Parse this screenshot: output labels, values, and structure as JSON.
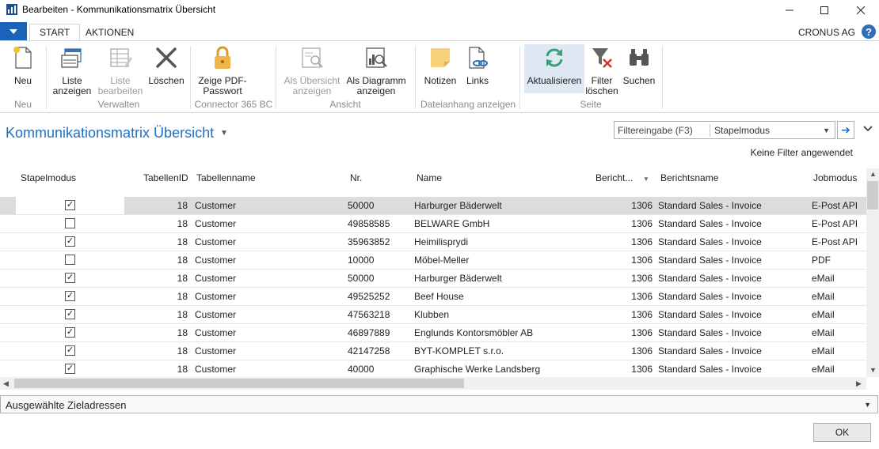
{
  "window": {
    "title": "Bearbeiten - Kommunikationsmatrix Übersicht"
  },
  "ribbon_tabs": {
    "start": "START",
    "actions": "AKTIONEN"
  },
  "company": "CRONUS AG",
  "help": "?",
  "ribbon": {
    "buttons": {
      "new": "Neu",
      "show_list": "Liste anzeigen",
      "edit_list": "Liste bearbeiten",
      "delete": "Löschen",
      "pdf_password": "Zeige PDF-Passwort",
      "show_as_overview": "Als Übersicht anzeigen",
      "show_as_chart": "Als Diagramm anzeigen",
      "notes": "Notizen",
      "links": "Links",
      "refresh": "Aktualisieren",
      "clear_filter": "Filter löschen",
      "find": "Suchen"
    },
    "groups": {
      "new": "Neu",
      "manage": "Verwalten",
      "connector": "Connector 365 BC",
      "view": "Ansicht",
      "attachments": "Dateianhang anzeigen",
      "page": "Seite"
    }
  },
  "page": {
    "title": "Kommunikationsmatrix Übersicht",
    "filter_placeholder": "Filtereingabe (F3)",
    "filter_field": "Stapelmodus",
    "no_filter": "Keine Filter angewendet"
  },
  "grid": {
    "headers": {
      "batch": "Stapelmodus",
      "table_id": "TabellenID",
      "table_name": "Tabellenname",
      "no": "Nr.",
      "name": "Name",
      "report": "Bericht...",
      "report_name": "Berichtsname",
      "job_mode": "Jobmodus"
    },
    "rows": [
      {
        "batch": true,
        "table_id": "18",
        "table_name": "Customer",
        "no": "50000",
        "name": "Harburger Bäderwelt",
        "report": "1306",
        "report_name": "Standard Sales - Invoice",
        "job_mode": "E-Post API"
      },
      {
        "batch": false,
        "table_id": "18",
        "table_name": "Customer",
        "no": "49858585",
        "name": "BELWARE GmbH",
        "report": "1306",
        "report_name": "Standard Sales - Invoice",
        "job_mode": "E-Post API"
      },
      {
        "batch": true,
        "table_id": "18",
        "table_name": "Customer",
        "no": "35963852",
        "name": "Heimilisprydi",
        "report": "1306",
        "report_name": "Standard Sales - Invoice",
        "job_mode": "E-Post API"
      },
      {
        "batch": false,
        "table_id": "18",
        "table_name": "Customer",
        "no": "10000",
        "name": "Möbel-Meller",
        "report": "1306",
        "report_name": "Standard Sales - Invoice",
        "job_mode": "PDF"
      },
      {
        "batch": true,
        "table_id": "18",
        "table_name": "Customer",
        "no": "50000",
        "name": "Harburger Bäderwelt",
        "report": "1306",
        "report_name": "Standard Sales - Invoice",
        "job_mode": "eMail"
      },
      {
        "batch": true,
        "table_id": "18",
        "table_name": "Customer",
        "no": "49525252",
        "name": "Beef House",
        "report": "1306",
        "report_name": "Standard Sales - Invoice",
        "job_mode": "eMail"
      },
      {
        "batch": true,
        "table_id": "18",
        "table_name": "Customer",
        "no": "47563218",
        "name": "Klubben",
        "report": "1306",
        "report_name": "Standard Sales - Invoice",
        "job_mode": "eMail"
      },
      {
        "batch": true,
        "table_id": "18",
        "table_name": "Customer",
        "no": "46897889",
        "name": "Englunds Kontorsmöbler AB",
        "report": "1306",
        "report_name": "Standard Sales - Invoice",
        "job_mode": "eMail"
      },
      {
        "batch": true,
        "table_id": "18",
        "table_name": "Customer",
        "no": "42147258",
        "name": "BYT-KOMPLET s.r.o.",
        "report": "1306",
        "report_name": "Standard Sales - Invoice",
        "job_mode": "eMail"
      },
      {
        "batch": true,
        "table_id": "18",
        "table_name": "Customer",
        "no": "40000",
        "name": "Graphische Werke Landsberg",
        "report": "1306",
        "report_name": "Standard Sales - Invoice",
        "job_mode": "eMail"
      }
    ]
  },
  "factbox": {
    "label": "Ausgewählte Zieladressen"
  },
  "ok_label": "OK"
}
